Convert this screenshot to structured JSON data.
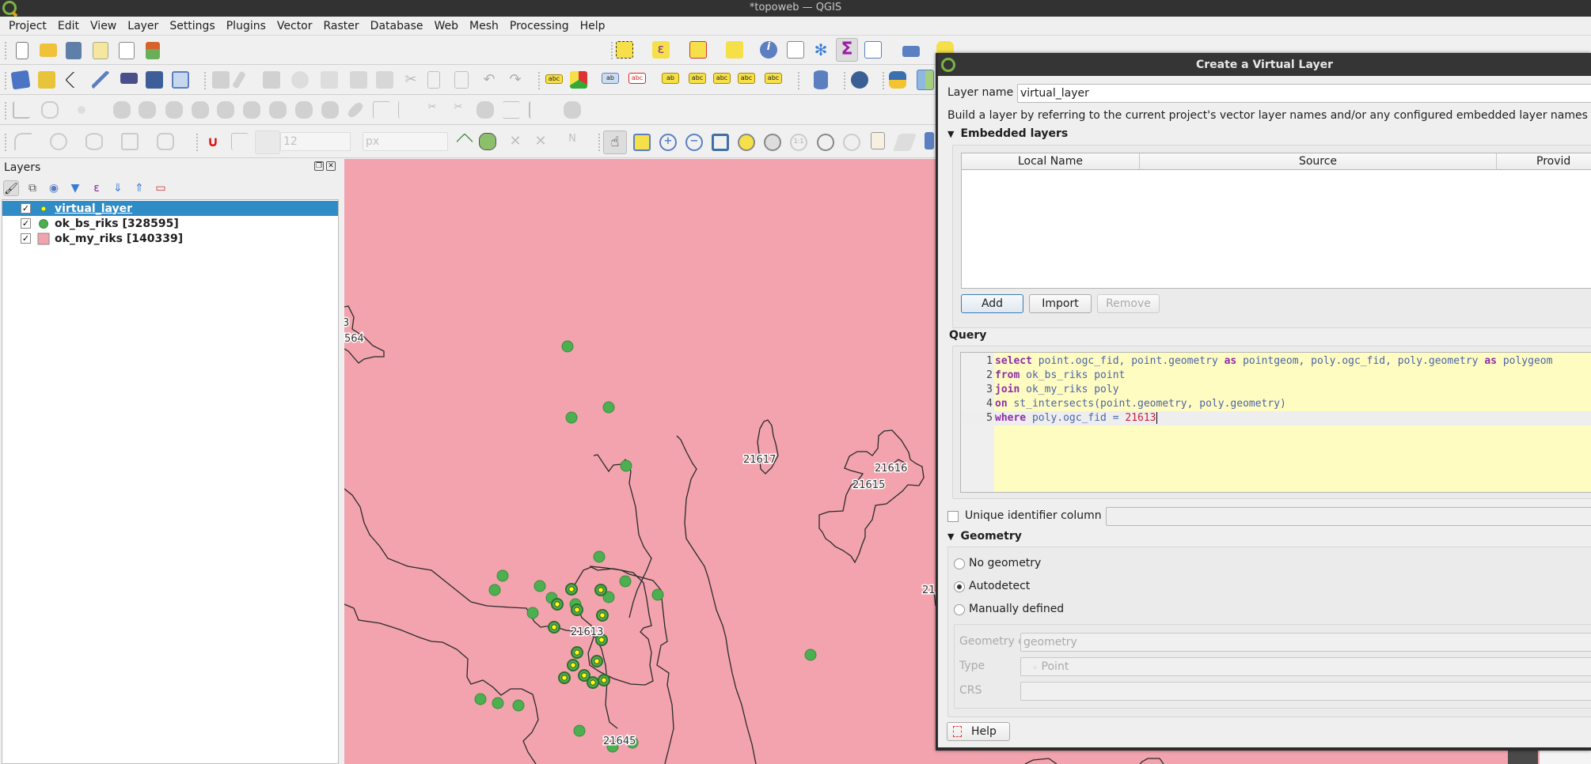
{
  "window": {
    "title": "*topoweb — QGIS"
  },
  "menu": [
    "Project",
    "Edit",
    "View",
    "Layer",
    "Settings",
    "Plugins",
    "Vector",
    "Raster",
    "Database",
    "Web",
    "Mesh",
    "Processing",
    "Help"
  ],
  "toolbars": {
    "project": [
      "new-project-icon",
      "open-project-icon",
      "save-project-icon",
      "new-print-layout-icon",
      "layout-manager-icon",
      "style-manager-icon"
    ],
    "attributes": [
      "select-features-icon",
      "select-by-expression-icon",
      "deselect-all-icon",
      "select-by-location-icon",
      "identify-features-icon",
      "statistics-icon",
      "processing-toolbox-icon",
      "show-statistical-summary-icon",
      "open-attribute-table-icon",
      "measure-line-icon",
      "map-tips-icon",
      "settings-gear-icon"
    ],
    "data_source": [
      "data-source-manager-icon",
      "new-geopackage-layer-icon",
      "new-shapefile-layer-icon",
      "new-temporary-scratch-layer-icon",
      "new-spatialite-layer-icon",
      "new-virtual-layer-icon",
      "new-mesh-layer-icon"
    ],
    "digitizing": [
      "current-edits-icon",
      "toggle-editing-icon",
      "save-layer-edits-icon",
      "add-point-feature-icon",
      "vertex-tool-icon",
      "modify-attributes-icon",
      "delete-selected-icon",
      "cut-features-icon",
      "copy-features-icon",
      "paste-features-icon",
      "undo-icon",
      "redo-icon"
    ],
    "labels": [
      "label-toolbar-icon",
      "diagram-options-icon",
      "highlight-pinned-labels-icon",
      "toggle-label-display-icon",
      "pin-unpin-labels-icon",
      "show-hide-labels-icon",
      "move-label-icon",
      "rotate-label-icon",
      "change-label-properties-icon"
    ],
    "database": [
      "db-manager-icon"
    ],
    "web": [
      "metasearch-icon"
    ],
    "plugins": [
      "python-console-icon",
      "map-swipe-icon"
    ],
    "snapping": {
      "tolerance_value": "12",
      "tolerance_unit": "px"
    },
    "navigation": [
      "pan-map-icon",
      "pan-to-selection-icon",
      "zoom-in-icon",
      "zoom-out-icon",
      "zoom-full-icon",
      "zoom-to-selection-icon",
      "zoom-to-layer-icon",
      "zoom-native-resolution-icon",
      "zoom-last-icon",
      "zoom-next-icon",
      "new-map-view-icon",
      "new-3d-map-view-icon",
      "new-spatial-bookmark-icon"
    ]
  },
  "layers_panel": {
    "title": "Layers",
    "items": [
      {
        "name": "virtual_layer",
        "checked": true,
        "selected": true,
        "symbol": "point-yellow"
      },
      {
        "name": "ok_bs_riks [328595]",
        "checked": true,
        "selected": false,
        "symbol": "point-green"
      },
      {
        "name": "ok_my_riks [140339]",
        "checked": true,
        "selected": false,
        "symbol": "fill-pink"
      }
    ]
  },
  "map": {
    "fill_color": "#f2a3ae",
    "point_color": "#4caf50",
    "selected_point_center": "#ffff00",
    "labels": [
      "21617",
      "21616",
      "21615",
      "21613",
      "21645",
      "564",
      "3",
      "21"
    ]
  },
  "dialog": {
    "title": "Create a Virtual Layer",
    "layer_name_label": "Layer name",
    "layer_name_value": "virtual_layer",
    "description": "Build a layer by referring to the current project's vector layer names and/or any configured embedded layer names as tables",
    "embedded_section": "Embedded layers",
    "table_headers": [
      "Local Name",
      "Source",
      "Provid"
    ],
    "buttons": {
      "add": "Add",
      "import": "Import",
      "remove": "Remove",
      "help": "Help"
    },
    "query_label": "Query",
    "query_lines": [
      {
        "n": "1",
        "tokens": [
          [
            "kw",
            "select"
          ],
          [
            "id",
            " point.ogc_fid, point.geometry "
          ],
          [
            "kw",
            "as"
          ],
          [
            "id",
            " pointgeom, poly.ogc_fid, poly.geometry "
          ],
          [
            "kw",
            "as"
          ],
          [
            "id",
            " polygeom"
          ]
        ]
      },
      {
        "n": "2",
        "tokens": [
          [
            "kw",
            "from"
          ],
          [
            "id",
            " ok_bs_riks point"
          ]
        ]
      },
      {
        "n": "3",
        "tokens": [
          [
            "kw",
            "join"
          ],
          [
            "id",
            " ok_my_riks poly"
          ]
        ]
      },
      {
        "n": "4",
        "tokens": [
          [
            "kw",
            "on"
          ],
          [
            "id",
            " st_intersects(point.geometry, poly.geometry)"
          ]
        ]
      },
      {
        "n": "5",
        "tokens": [
          [
            "kw",
            "where"
          ],
          [
            "id",
            " poly.ogc_fid = "
          ],
          [
            "num",
            "21613"
          ]
        ]
      }
    ],
    "unique_id_label": "Unique identifier column",
    "unique_id_checked": false,
    "unique_id_value": "",
    "geometry_section": "Geometry",
    "geometry_options": [
      "No geometry",
      "Autodetect",
      "Manually defined"
    ],
    "geometry_selected": "Autodetect",
    "geometry_column_label": "Geometry column",
    "geometry_column_value": "geometry",
    "type_label": "Type",
    "type_value": "Point",
    "crs_label": "CRS",
    "crs_value": ""
  }
}
